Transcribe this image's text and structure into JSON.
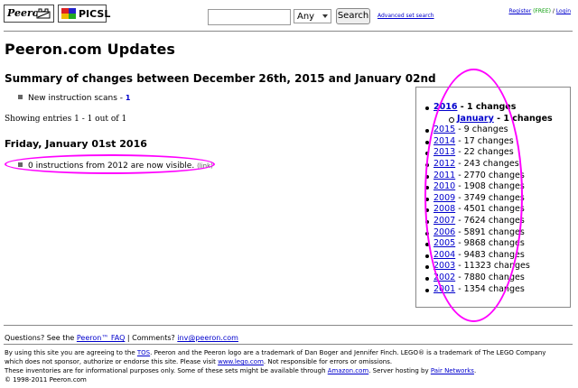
{
  "header": {
    "logo1_text": "Peeron",
    "logo2_text": "PICSL",
    "search_value": "",
    "select_value": "Any",
    "search_button": "Search",
    "advanced_link": "Advanced set search",
    "register_link": "Register",
    "free_text": "(FREE)",
    "slash": " / ",
    "login_link": "Login"
  },
  "page_title": "Peeron.com Updates",
  "summary": {
    "title": "Summary of changes between December 26th, 2015 and January 02nd",
    "item_label": "New instruction scans - ",
    "item_count": "1"
  },
  "showing_text": "Showing entries 1 - 1 out of 1",
  "day": {
    "title": "Friday, January 01st 2016",
    "item_text": "0 instructions from 2012 are now visible. ",
    "item_link": "(link)"
  },
  "years": {
    "top": {
      "year": "2016",
      "suffix": " - 1 changes"
    },
    "month": {
      "name": "January",
      "suffix": " - 1 changes"
    },
    "list": [
      {
        "year": "2015",
        "suffix": " - 9 changes"
      },
      {
        "year": "2014",
        "suffix": " - 17 changes"
      },
      {
        "year": "2013",
        "suffix": " - 22 changes"
      },
      {
        "year": "2012",
        "suffix": " - 243 changes"
      },
      {
        "year": "2011",
        "suffix": " - 2770 changes"
      },
      {
        "year": "2010",
        "suffix": " - 1908 changes"
      },
      {
        "year": "2009",
        "suffix": " - 3749 changes"
      },
      {
        "year": "2008",
        "suffix": " - 4501 changes"
      },
      {
        "year": "2007",
        "suffix": " - 7624 changes"
      },
      {
        "year": "2006",
        "suffix": " - 5891 changes"
      },
      {
        "year": "2005",
        "suffix": " - 9868 changes"
      },
      {
        "year": "2004",
        "suffix": " - 9483 changes"
      },
      {
        "year": "2003",
        "suffix": " - 11323 changes"
      },
      {
        "year": "2002",
        "suffix": " - 7880 changes"
      },
      {
        "year": "2001",
        "suffix": " - 1354 changes"
      }
    ]
  },
  "footer": {
    "q_prefix": "Questions? See the ",
    "faq_link": "Peeron™ FAQ",
    "q_mid": " | Comments? ",
    "email_link": "inv@peeron.com",
    "line1_a": "By using this site you are agreeing to the ",
    "tos_link": "TOS",
    "line1_b": ". Peeron and the Peeron logo are a trademark of Dan Boger and Jennifer Finch. LEGO® is a trademark of The LEGO Company",
    "line2_a": "which does not sponsor, authorize or endorse this site.  Please visit ",
    "lego_link": "www.lego.com",
    "line2_b": ".   Not responsible for errors or omissions.",
    "line3_a": "These inventories are for informational purposes only.  Some of these sets might be available through ",
    "amazon_link": "Amazon.com",
    "line3_b": ". Server hosting by ",
    "pair_link": "Pair Networks",
    "line3_c": ".",
    "copyright": "© 1998-2011 Peeron.com"
  },
  "colors": {
    "link": "#0000cc",
    "annotation": "#ff00ff",
    "free": "#009900"
  }
}
